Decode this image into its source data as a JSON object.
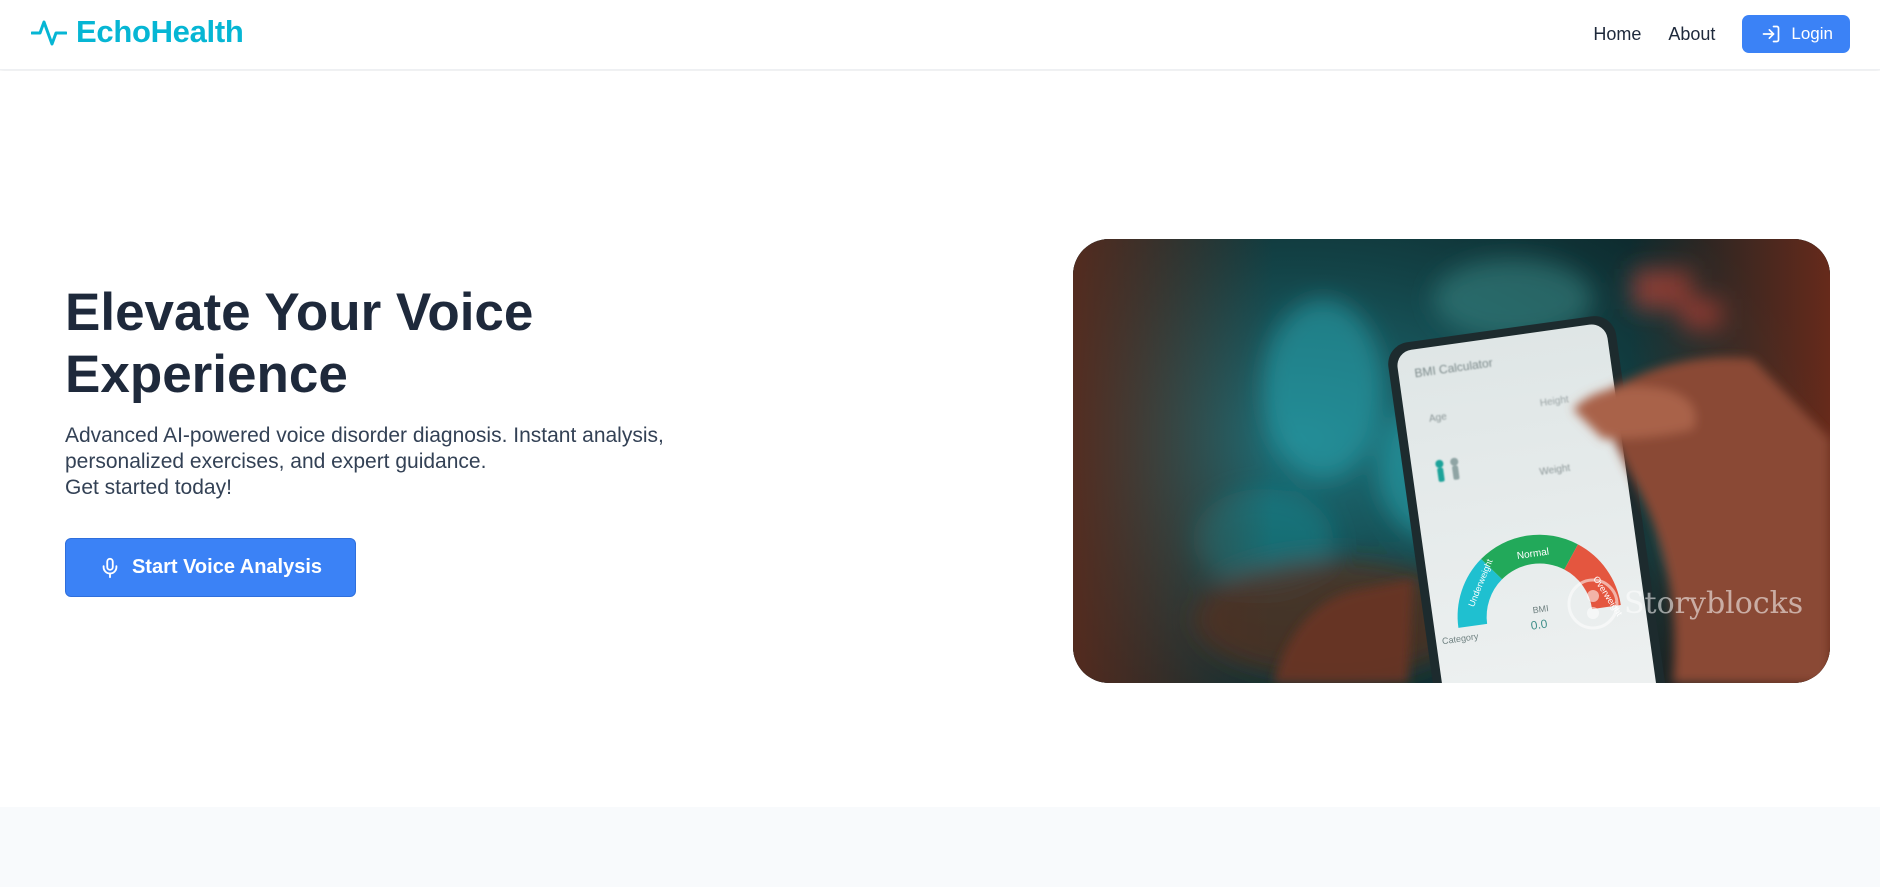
{
  "brand": {
    "name": "EchoHealth",
    "icon": "pulse-icon",
    "color": "#06b6d4"
  },
  "nav": {
    "items": [
      {
        "label": "Home"
      },
      {
        "label": "About"
      }
    ],
    "login_label": "Login",
    "login_icon": "login-arrow-icon"
  },
  "hero": {
    "title": "Elevate Your Voice Experience",
    "subtitle_lines": [
      "Advanced AI-powered voice disorder diagnosis. Instant analysis,",
      "personalized exercises, and expert guidance.",
      "Get started today!"
    ],
    "cta_label": "Start Voice Analysis",
    "cta_icon": "microphone-icon",
    "image": {
      "app_title": "BMI Calculator",
      "age_label": "Age",
      "height_label": "Height",
      "weight_label": "Weight",
      "gauge_labels": [
        "Underweight",
        "Normal",
        "Overweight"
      ],
      "bmi_label": "BMI",
      "bmi_value": "0.0",
      "category_label": "Category",
      "watermark": "Storyblocks"
    }
  },
  "colors": {
    "accent": "#3b82f6",
    "heading": "#1e293b",
    "brand": "#06b6d4"
  }
}
